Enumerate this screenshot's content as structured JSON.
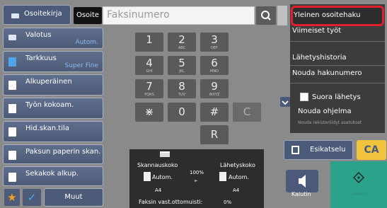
{
  "header": {
    "address_book_label": "Osoitekirja",
    "address_label": "Osoite",
    "fax_number_placeholder": "Faksinumero"
  },
  "left_buttons": [
    {
      "label": "Valotus",
      "value": "Autom."
    },
    {
      "label": "Tarkkuus",
      "value": "Super Fine"
    },
    {
      "label": "Alkuperäinen",
      "value": ""
    },
    {
      "label": "Työn kokoam.",
      "value": ""
    },
    {
      "label": "Hid.skan.tila",
      "value": ""
    },
    {
      "label": "Paksun paperin skan.",
      "value": ""
    },
    {
      "label": "Sekakok alkup.",
      "value": ""
    }
  ],
  "bottom_left": {
    "more_label": "Muut"
  },
  "keypad": {
    "keys": [
      {
        "main": "1",
        "sub": ""
      },
      {
        "main": "2",
        "sub": "ABC"
      },
      {
        "main": "3",
        "sub": "DEF"
      },
      {
        "main": "4",
        "sub": "GHI"
      },
      {
        "main": "5",
        "sub": "JKL"
      },
      {
        "main": "6",
        "sub": "MNO"
      },
      {
        "main": "7",
        "sub": "PQRS"
      },
      {
        "main": "8",
        "sub": "TUV"
      },
      {
        "main": "9",
        "sub": "WXYZ"
      },
      {
        "main": "⋇",
        "sub": ""
      },
      {
        "main": "0",
        "sub": ""
      },
      {
        "main": "#",
        "sub": ""
      }
    ],
    "clear_key": "C",
    "r_key": "R"
  },
  "size_panel": {
    "scan_size_label": "Skannauskoko",
    "send_size_label": "Lähetyskoko",
    "scan_value": "Autom.",
    "send_value": "Autom.",
    "scan_paper": "A4",
    "send_paper": "A4",
    "zoom": "100%",
    "memory_label": "Faksin vast.ottomuisti:",
    "memory_value": "0%"
  },
  "right_menu": {
    "global_search": "Yleinen osoitehaku",
    "recent": "Viimeiset työt",
    "history": "Lähetyshistoria",
    "retrieve_number": "Nouda hakunumero",
    "direct_send": "Suora lähetys",
    "program": "Nouda ohjelma",
    "program_sub": "Nouda rekisteröidyt asetukset"
  },
  "actions": {
    "preview": "Esikatselu",
    "ca": "CA",
    "speaker": "Kaiutin",
    "start": "Aloita"
  },
  "colors": {
    "highlight": "#e0202a",
    "ca": "#f0c33c",
    "start": "#2aa38a"
  }
}
